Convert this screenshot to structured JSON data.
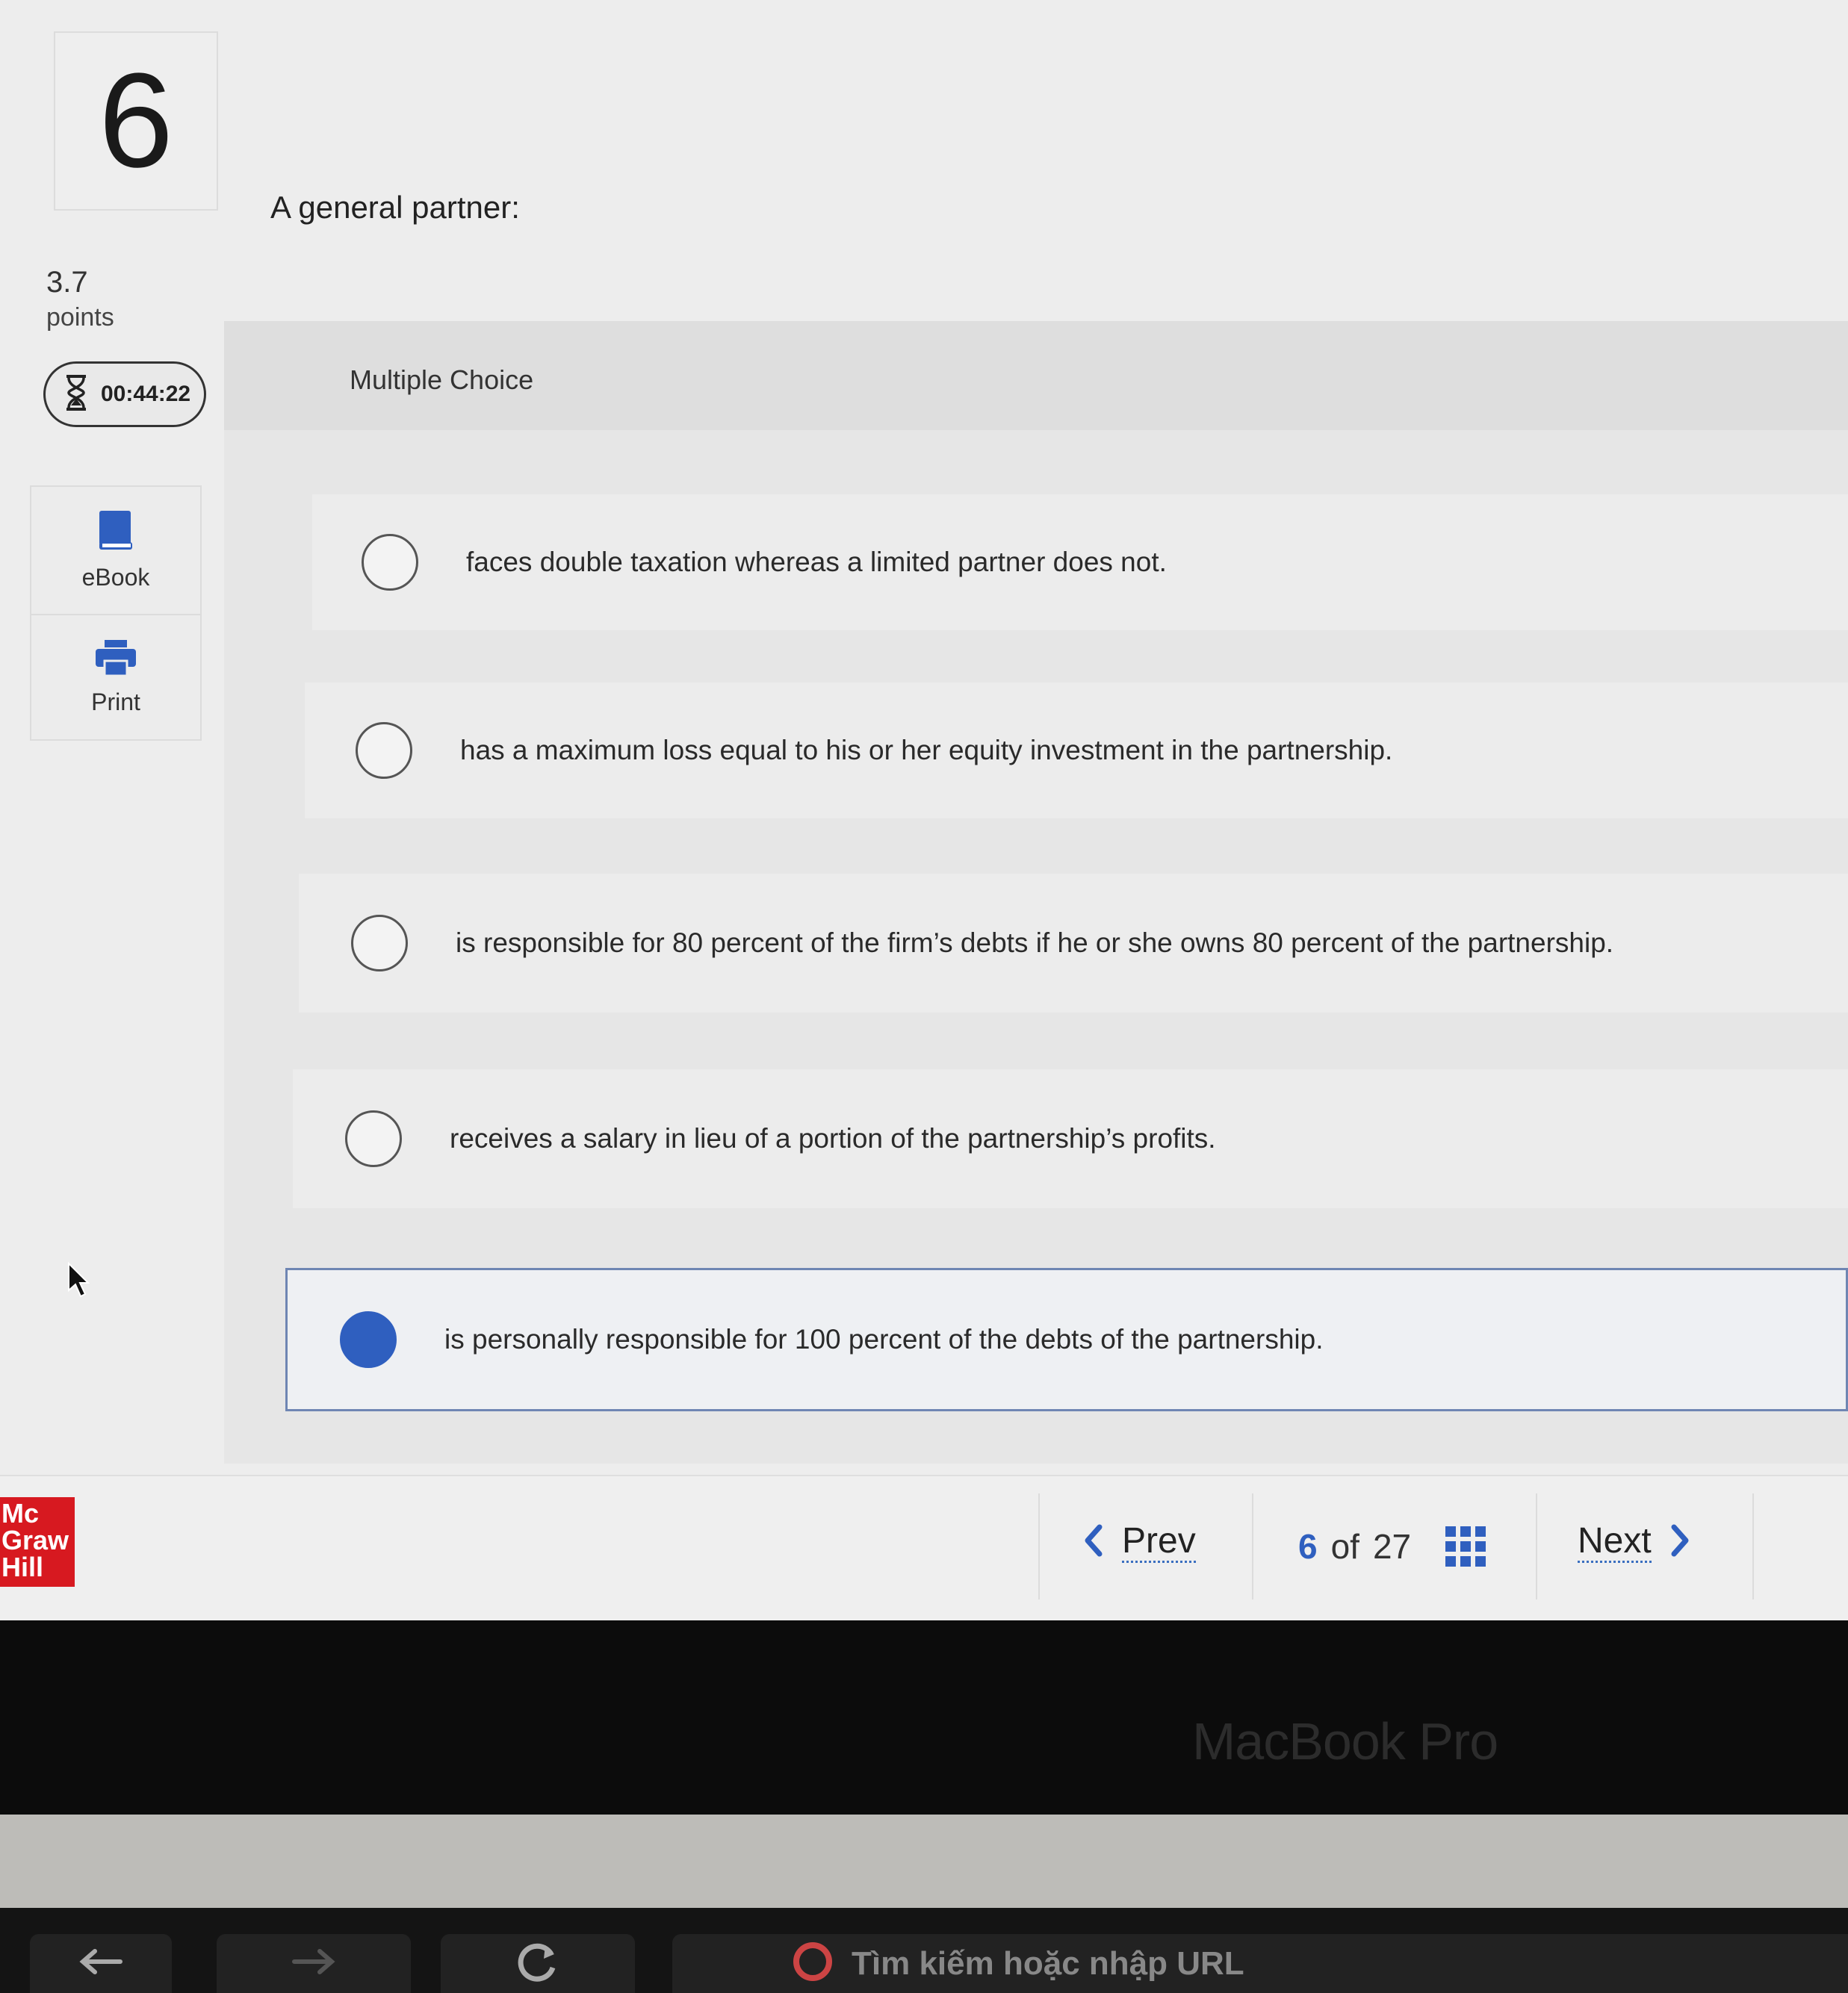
{
  "question": {
    "number": "6",
    "points_value": "3.7",
    "points_label": "points",
    "timer": "00:44:22",
    "prompt": "A general partner:",
    "type_label": "Multiple Choice",
    "options": [
      {
        "text": "faces double taxation whereas a limited partner does not.",
        "selected": false
      },
      {
        "text": "has a maximum loss equal to his or her equity investment in the partnership.",
        "selected": false
      },
      {
        "text": "is responsible for 80 percent of the firm’s debts if he or she owns 80 percent of the partnership.",
        "selected": false
      },
      {
        "text": "receives a salary in lieu of a portion of the partnership’s profits.",
        "selected": false
      },
      {
        "text": "is personally responsible for 100 percent of the debts of the partnership.",
        "selected": true
      }
    ]
  },
  "tools": {
    "ebook_label": "eBook",
    "print_label": "Print"
  },
  "footer": {
    "logo_lines": [
      "Mc",
      "Graw",
      "Hill"
    ],
    "prev_label": "Prev",
    "next_label": "Next",
    "current_page": "6",
    "of_label": "of",
    "total_pages": "27"
  },
  "device": {
    "brand": "MacBook Pro",
    "url_placeholder": "Tìm kiếm hoặc nhập URL"
  },
  "colors": {
    "accent": "#2f5fbf",
    "logo_red": "#d71920"
  }
}
